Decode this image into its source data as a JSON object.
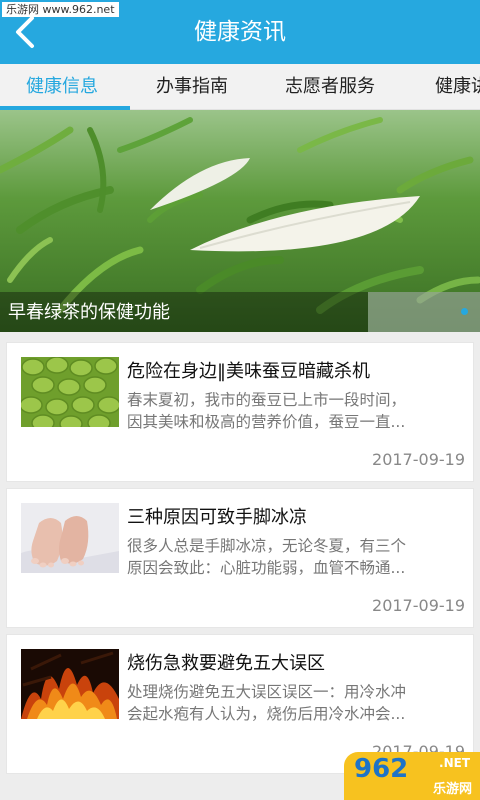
{
  "watermark": "乐游网 www.962.net",
  "header": {
    "title": "健康资讯"
  },
  "tabs": [
    {
      "label": "健康信息",
      "active": true
    },
    {
      "label": "办事指南",
      "active": false
    },
    {
      "label": "志愿者服务",
      "active": false
    },
    {
      "label": "健康讲",
      "active": false
    }
  ],
  "banner": {
    "caption": "早春绿茶的保健功能"
  },
  "articles": [
    {
      "title": "危险在身边‖美味蚕豆暗藏杀机",
      "summary_line1": "春末夏初，我市的蚕豆已上市一段时间，",
      "summary_line2": "因其美味和极高的营养价值，蚕豆一直...",
      "date": "2017-09-19"
    },
    {
      "title": "三种原因可致手脚冰凉",
      "summary_line1": "很多人总是手脚冰凉，无论冬夏，有三个",
      "summary_line2": "原因会致此：心脏功能弱，血管不畅通...",
      "date": "2017-09-19"
    },
    {
      "title": "烧伤急救要避免五大误区",
      "summary_line1": "处理烧伤避免五大误区误区一：用冷水冲",
      "summary_line2": "会起水疱有人认为，烧伤后用冷水冲会...",
      "date": "2017-09-19"
    }
  ],
  "corner_logo": {
    "number": "962",
    "net": ".NET",
    "name": "乐游网"
  },
  "colors": {
    "accent": "#26a8df",
    "background": "#ededed"
  }
}
